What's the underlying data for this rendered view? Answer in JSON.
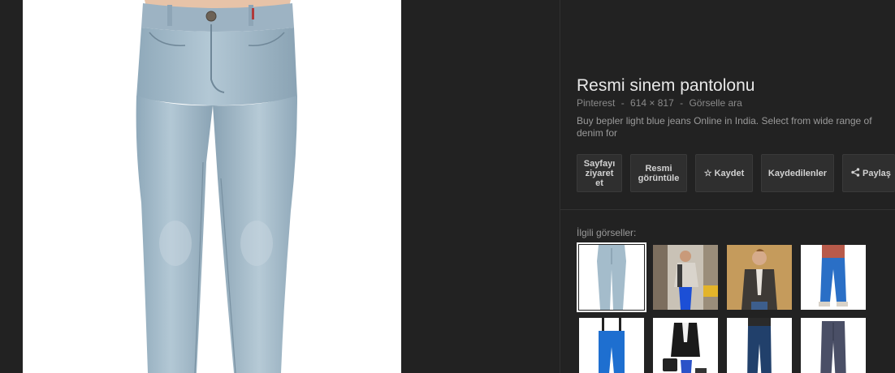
{
  "preview": {
    "image_description_icon": "jeans-image"
  },
  "info": {
    "title": "Resmi sinem pantolonu",
    "source": "Pinterest",
    "separator1": "-",
    "dimensions": "614 × 817",
    "separator2": "-",
    "search_image": "Görselle ara",
    "description": "Buy bepler light blue jeans Online in India. Select from wide range of denim for"
  },
  "actions": {
    "visit_page": "Sayfayı ziyaret et",
    "view_image": "Resmi görüntüle",
    "save_icon": "star-icon",
    "save": "Kaydet",
    "saved": "Kaydedilenler",
    "share_icon": "share-icon",
    "share": "Paylaş"
  },
  "related": {
    "label": "İlgili görseller:",
    "thumbnails": [
      {
        "icon": "light-jeans-thumbnail",
        "selected": true
      },
      {
        "icon": "street-fashion-thumbnail",
        "selected": false
      },
      {
        "icon": "blazer-man-thumbnail",
        "selected": false
      },
      {
        "icon": "blue-jeans-man-thumbnail",
        "selected": false
      },
      {
        "icon": "ski-pants-thumbnail",
        "selected": false
      },
      {
        "icon": "suit-outfit-thumbnail",
        "selected": false
      },
      {
        "icon": "dark-jeans-thumbnail",
        "selected": false
      },
      {
        "icon": "grey-trousers-thumbnail",
        "selected": false
      }
    ]
  },
  "colors": {
    "background": "#222222",
    "button_bg": "#2f2f2f",
    "denim_light": "#9bb4c4",
    "denim_bright": "#1e6fd0"
  }
}
